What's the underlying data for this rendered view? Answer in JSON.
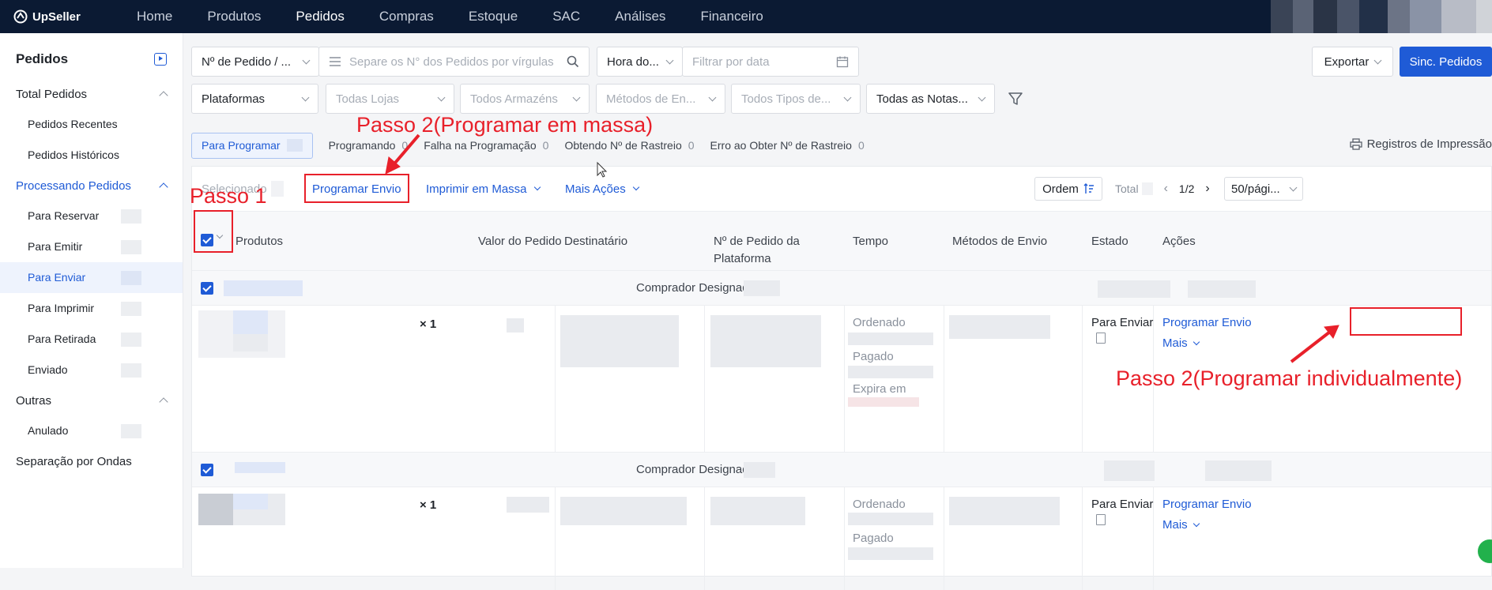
{
  "app": {
    "brand": "UpSeller"
  },
  "nav": {
    "items": [
      "Home",
      "Produtos",
      "Pedidos",
      "Compras",
      "Estoque",
      "SAC",
      "Análises",
      "Financeiro"
    ],
    "active": "Pedidos"
  },
  "sidebar": {
    "title": "Pedidos",
    "groups": {
      "total": "Total Pedidos",
      "recentes": "Pedidos Recentes",
      "historicos": "Pedidos Históricos",
      "processando": "Processando Pedidos",
      "reservar": "Para Reservar",
      "emitir": "Para Emitir",
      "enviar": "Para Enviar",
      "imprimir": "Para Imprimir",
      "retirada": "Para Retirada",
      "enviado": "Enviado",
      "outras": "Outras",
      "anulado": "Anulado",
      "ondas": "Separação por Ondas"
    }
  },
  "filters": {
    "order_type": "Nº de Pedido / ...",
    "search_placeholder": "Separe os N° dos Pedidos por vírgulas",
    "time_type": "Hora do...",
    "date_placeholder": "Filtrar por data",
    "platforms": "Plataformas",
    "stores": "Todas Lojas",
    "warehouses": "Todos Armazéns",
    "ship_methods": "Métodos de En...",
    "types": "Todos Tipos de...",
    "notes": "Todas as Notas...",
    "export": "Exportar",
    "sync": "Sinc. Pedidos"
  },
  "tabs": [
    {
      "label": "Para Programar",
      "count": ""
    },
    {
      "label": "Programando",
      "count": "0"
    },
    {
      "label": "Falha na Programação",
      "count": "0"
    },
    {
      "label": "Obtendo Nº de Rastreio",
      "count": "0"
    },
    {
      "label": "Erro ao Obter Nº de Rastreio",
      "count": "0"
    }
  ],
  "print_log": "Registros de Impressão",
  "toolbar": {
    "selected": "Selecionado",
    "schedule": "Programar Envio",
    "bulk_print": "Imprimir em Massa",
    "more_actions": "Mais Ações",
    "order": "Ordem",
    "total": "Total",
    "page": "1/2",
    "page_size": "50/pági..."
  },
  "table": {
    "columns": {
      "products": "Produtos",
      "value": "Valor do Pedido",
      "recipient": "Destinatário",
      "platform_no_1": "Nº de Pedido da",
      "platform_no_2": "Plataforma",
      "time": "Tempo",
      "ship_method": "Métodos de Envio",
      "status": "Estado",
      "actions": "Ações"
    },
    "buyer_label": "Comprador Designado:",
    "rows": [
      {
        "qty": "× 1",
        "ordered": "Ordenado",
        "paid": "Pagado",
        "expires": "Expira em",
        "status": "Para Enviar",
        "action": "Programar Envio",
        "more": "Mais"
      },
      {
        "qty": "× 1",
        "ordered": "Ordenado",
        "paid": "Pagado",
        "status": "Para Enviar",
        "action": "Programar Envio",
        "more": "Mais"
      }
    ]
  },
  "annotations": {
    "step1": "Passo 1",
    "step2_bulk": "Passo 2(Programar em massa)",
    "step2_single": "Passo 2(Programar individualmente)"
  },
  "colors": {
    "accent": "#1f5bd6",
    "nav_bg": "#0b1a33",
    "annotation": "#e8202a"
  }
}
